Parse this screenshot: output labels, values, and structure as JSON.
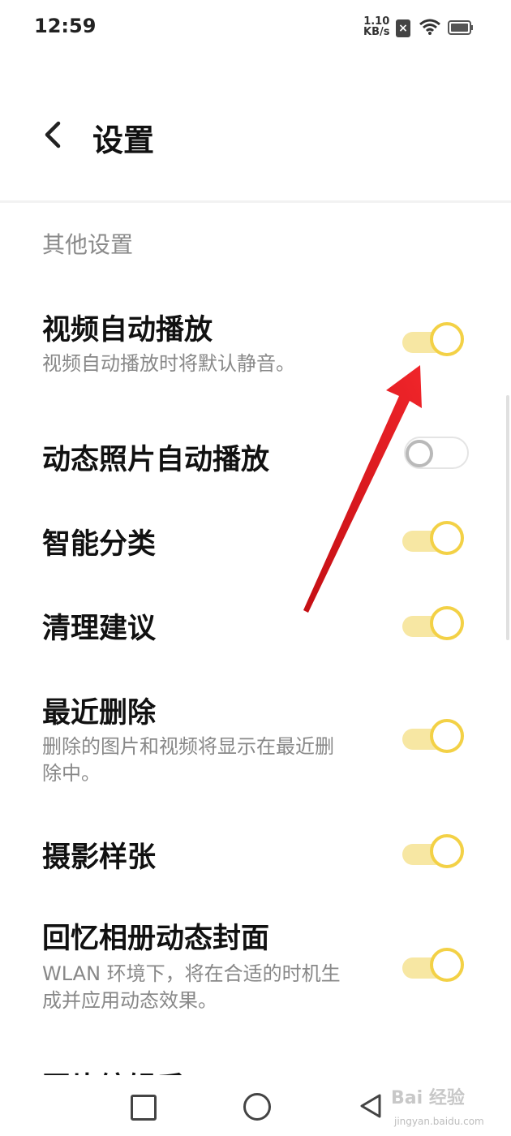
{
  "status_bar": {
    "time": "12:59",
    "net_speed_value": "1.10",
    "net_speed_unit": "KB/s",
    "sim_icon": "no-sim-icon",
    "wifi_icon": "wifi-icon",
    "battery_icon": "battery-icon"
  },
  "header": {
    "back_icon": "chevron-left-icon",
    "title": "设置"
  },
  "section": {
    "title": "其他设置"
  },
  "settings": [
    {
      "title": "视频自动播放",
      "subtitle": "视频自动播放时将默认静音。",
      "enabled": true
    },
    {
      "title": "动态照片自动播放",
      "subtitle": "",
      "enabled": false
    },
    {
      "title": "智能分类",
      "subtitle": "",
      "enabled": true
    },
    {
      "title": "清理建议",
      "subtitle": "",
      "enabled": true
    },
    {
      "title": "最近删除",
      "subtitle": "删除的图片和视频将显示在最近删除中。",
      "enabled": true
    },
    {
      "title": "摄影样张",
      "subtitle": "",
      "enabled": true
    },
    {
      "title": "回忆相册动态封面",
      "subtitle": "WLAN 环境下，将在合适的时机生成并应用动态效果。",
      "enabled": true
    }
  ],
  "partial_row": {
    "title": "图片编辑后"
  },
  "colors": {
    "toggle_on_knob": "#f3d146",
    "toggle_on_track": "#f7e7a3",
    "annotation_arrow": "#e8141a"
  },
  "nav_bar": {
    "recent_icon": "square-icon",
    "home_icon": "circle-icon",
    "back_icon": "triangle-back-icon"
  },
  "watermark": {
    "text": "Bai 经验",
    "url": "jingyan.baidu.com"
  }
}
